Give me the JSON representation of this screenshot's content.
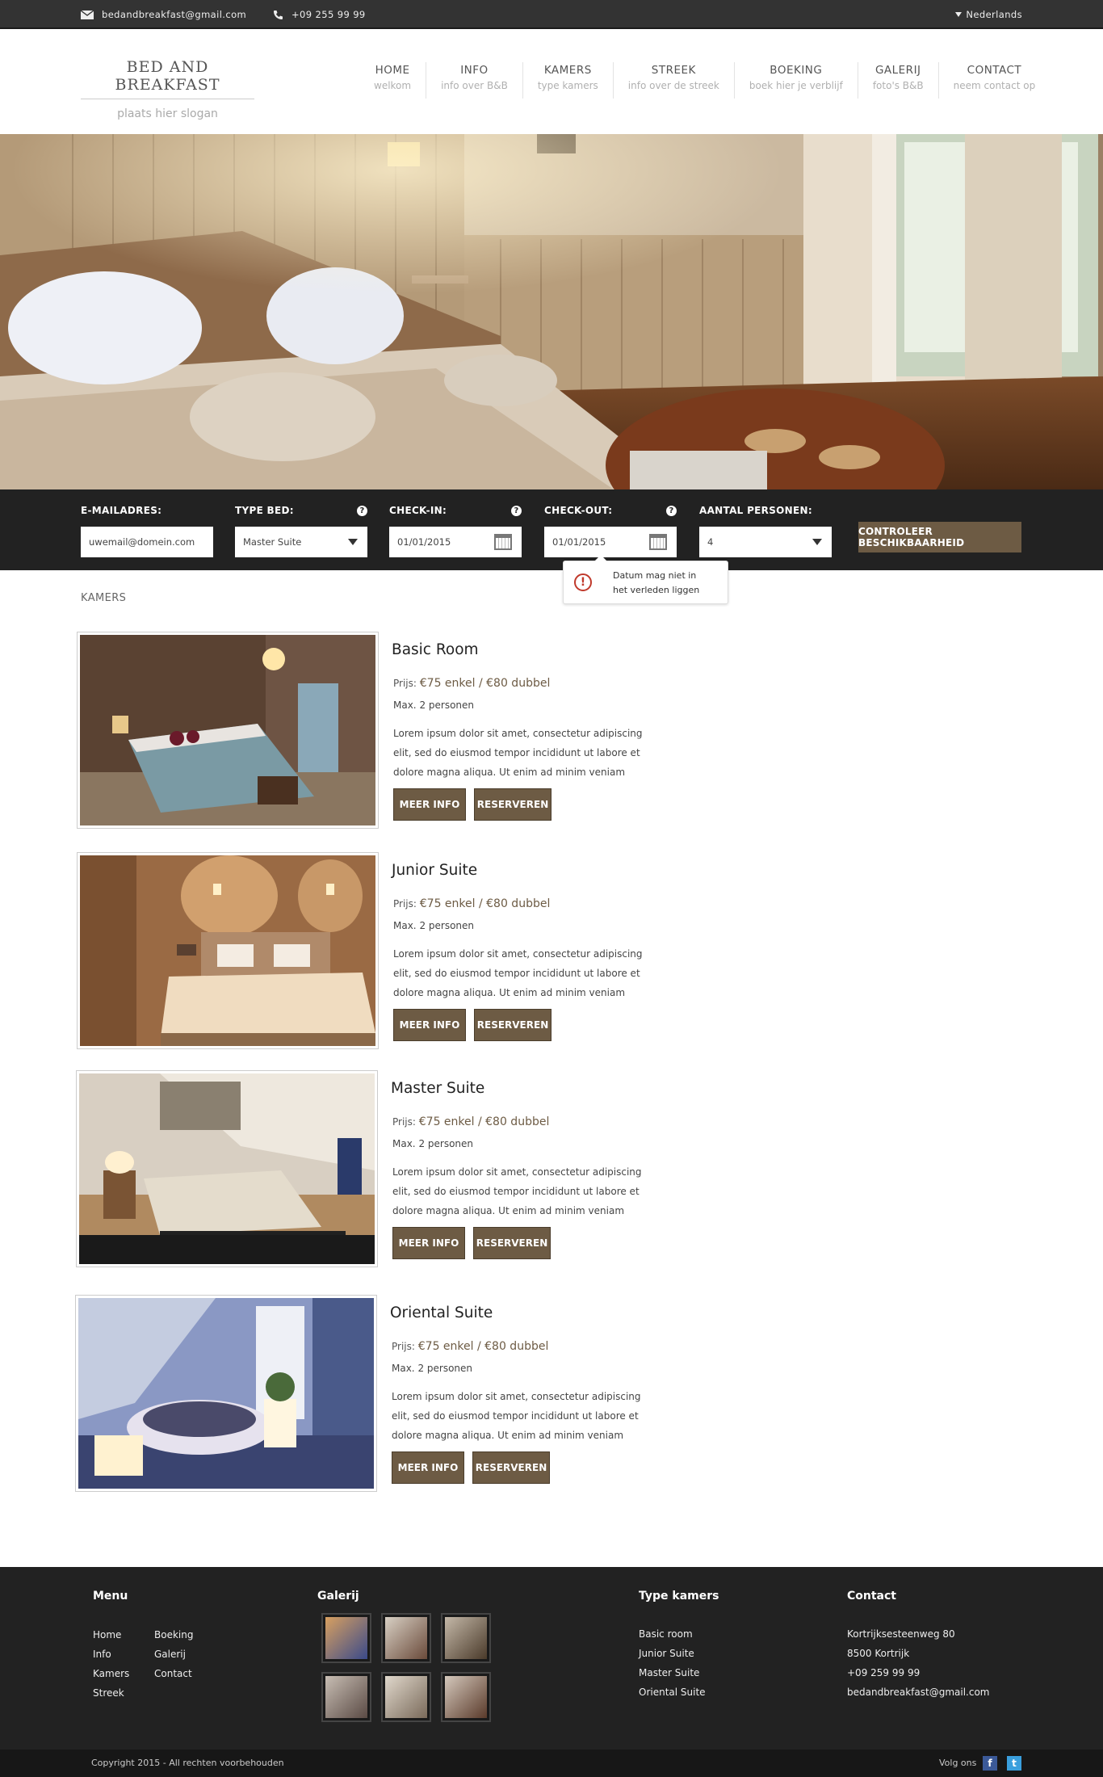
{
  "topbar": {
    "email": "bedandbreakfast@gmail.com",
    "phone": "+09 255 99 99",
    "language": "Nederlands",
    "icons": {
      "email": "envelope-icon",
      "phone": "phone-icon",
      "language": "caret-down-icon"
    }
  },
  "logo": {
    "name": "BED AND BREAKFAST",
    "slogan": "plaats hier slogan"
  },
  "nav": [
    {
      "label": "HOME",
      "sub": "welkom"
    },
    {
      "label": "INFO",
      "sub": "info over B&B"
    },
    {
      "label": "KAMERS",
      "sub": "type kamers"
    },
    {
      "label": "STREEK",
      "sub": "info over de streek"
    },
    {
      "label": "BOEKING",
      "sub": "boek hier je verblijf"
    },
    {
      "label": "GALERIJ",
      "sub": "foto's B&B"
    },
    {
      "label": "CONTACT",
      "sub": "neem contact op"
    }
  ],
  "booking": {
    "email_label": "E-MAILADRES:",
    "email_placeholder": "uwemail@domein.com",
    "bed_label": "TYPE BED:",
    "bed_value": "Master Suite",
    "checkin_label": "CHECK-IN:",
    "checkin_value": "01/01/2015",
    "checkout_label": "CHECK-OUT:",
    "checkout_value": "01/01/2015",
    "persons_label": "AANTAL PERSONEN:",
    "persons_value": "4",
    "button": "CONTROLEER BESCHIKBAARHEID",
    "help_icon": "?",
    "tooltip_line1": "Datum mag niet in",
    "tooltip_line2": "het verleden liggen",
    "warn_icon": "!"
  },
  "rooms_title": "KAMERS",
  "rooms": [
    {
      "title": "Basic Room",
      "price_label": "Prijs:",
      "price": "€75 enkel / €80 dubbel",
      "max": "Max. 2 personen",
      "desc": "Lorem ipsum dolor sit amet, consectetur adipiscing elit, sed do eiusmod tempor incididunt ut labore et dolore magna aliqua. Ut enim ad minim veniam",
      "more": "MEER INFO",
      "reserve": "RESERVEREN"
    },
    {
      "title": "Junior Suite",
      "price_label": "Prijs:",
      "price": "€75 enkel / €80 dubbel",
      "max": "Max. 2 personen",
      "desc": "Lorem ipsum dolor sit amet, consectetur adipiscing elit, sed do eiusmod tempor incididunt ut labore et dolore magna aliqua. Ut enim ad minim veniam",
      "more": "MEER INFO",
      "reserve": "RESERVEREN"
    },
    {
      "title": "Master Suite",
      "price_label": "Prijs:",
      "price": "€75 enkel / €80 dubbel",
      "max": "Max. 2 personen",
      "desc": "Lorem ipsum dolor sit amet, consectetur adipiscing elit, sed do eiusmod tempor incididunt ut labore et dolore magna aliqua. Ut enim ad minim veniam",
      "more": "MEER INFO",
      "reserve": "RESERVEREN"
    },
    {
      "title": "Oriental Suite",
      "price_label": "Prijs:",
      "price": "€75 enkel / €80 dubbel",
      "max": "Max. 2 personen",
      "desc": "Lorem ipsum dolor sit amet, consectetur adipiscing elit, sed do eiusmod tempor incididunt ut labore et dolore magna aliqua. Ut enim ad minim veniam",
      "more": "MEER INFO",
      "reserve": "RESERVEREN"
    }
  ],
  "footer": {
    "menu_title": "Menu",
    "menu_col1": [
      "Home",
      "Info",
      "Kamers",
      "Streek"
    ],
    "menu_col2": [
      "Boeking",
      "Galerij",
      "Contact"
    ],
    "gallery_title": "Galerij",
    "types_title": "Type kamers",
    "types": [
      "Basic room",
      "Junior Suite",
      "Master Suite",
      "Oriental Suite"
    ],
    "contact_title": "Contact",
    "contact": [
      "Kortrijksesteenweg 80",
      "8500 Kortrijk",
      "+09 259 99 99",
      "bedandbreakfast@gmail.com"
    ],
    "copyright": "Copyright 2015 - All rechten voorbehouden",
    "follow": "Volg ons",
    "facebook": "f",
    "twitter": "t"
  },
  "colors": {
    "accent": "#6d5b44",
    "dark": "#222222",
    "topbar": "#333333"
  }
}
